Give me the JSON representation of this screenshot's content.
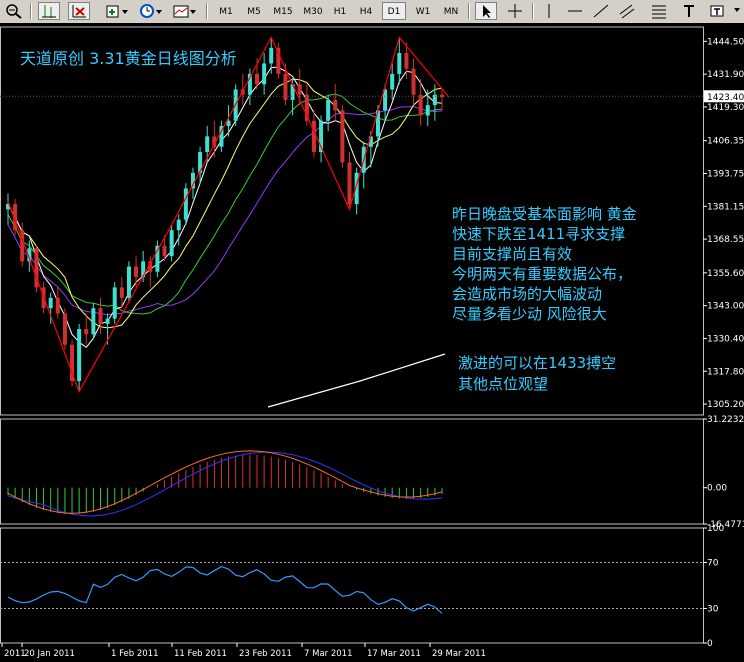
{
  "toolbar": {
    "timeframes": [
      "M1",
      "M5",
      "M15",
      "M30",
      "H1",
      "H4",
      "D1",
      "W1",
      "MN"
    ],
    "active_timeframe": "D1",
    "icons": [
      "zoom-out-icon",
      "bar-chart-icon",
      "grid-icon",
      "new-order-icon",
      "clock-icon",
      "templates-icon",
      "cursor-icon",
      "crosshair-icon",
      "line-icon",
      "horizontal-line-icon",
      "trendline-icon",
      "channel-icon",
      "fibonacci-icon",
      "text-icon",
      "label-icon"
    ]
  },
  "colors": {
    "background": "#000000",
    "bull_candle": "#40e0d0",
    "bear_candle": "#d03030",
    "ma_fast": "#ffffff",
    "ma_mid": "#ffff66",
    "ma_slow1": "#33cc33",
    "ma_slow2": "#9933ff",
    "zigzag": "#ff0000",
    "annotation": "#33ccff",
    "macd_pos": "#dd3333",
    "macd_neg": "#33cc33",
    "macd_signal": "#3333ff",
    "macd_line": "#ff6633",
    "osc_line": "#3399ff"
  },
  "annotations": {
    "title": "天道原创 3.31黄金日线图分析",
    "analysis_lines": [
      "昨日晚盘受基本面影响 黄金",
      "快速下跌至1411寻求支撑",
      "目前支撑尚且有效",
      "今明两天有重要数据公布，",
      "会造成市场的大幅波动",
      "尽量多看少动 风险很大"
    ],
    "strategy_lines": [
      "激进的可以在1433搏空",
      "其他点位观望"
    ]
  },
  "chart_data": [
    {
      "type": "candlestick",
      "yticks": [
        1444.5,
        1431.9,
        1419.3,
        1406.35,
        1393.75,
        1381.15,
        1368.55,
        1355.6,
        1343.0,
        1330.4,
        1317.8,
        1305.2
      ],
      "ylim": [
        1301,
        1450
      ],
      "current_price": 1423.4,
      "xtick_labels": [
        "2011",
        "20 Jan 2011",
        "1 Feb 2011",
        "11 Feb 2011",
        "23 Feb 2011",
        "7 Mar 2011",
        "17 Mar 2011",
        "29 Mar 2011"
      ],
      "candles_ohlc": [
        [
          1380,
          1386,
          1374,
          1382
        ],
        [
          1382,
          1384,
          1370,
          1372
        ],
        [
          1372,
          1375,
          1358,
          1360
        ],
        [
          1360,
          1368,
          1356,
          1365
        ],
        [
          1365,
          1366,
          1348,
          1350
        ],
        [
          1350,
          1352,
          1340,
          1342
        ],
        [
          1342,
          1348,
          1336,
          1346
        ],
        [
          1346,
          1350,
          1338,
          1340
        ],
        [
          1340,
          1342,
          1326,
          1328
        ],
        [
          1328,
          1330,
          1312,
          1314
        ],
        [
          1314,
          1336,
          1310,
          1334
        ],
        [
          1334,
          1340,
          1328,
          1332
        ],
        [
          1332,
          1344,
          1330,
          1342
        ],
        [
          1342,
          1346,
          1332,
          1336
        ],
        [
          1336,
          1340,
          1328,
          1338
        ],
        [
          1338,
          1352,
          1336,
          1350
        ],
        [
          1350,
          1354,
          1342,
          1346
        ],
        [
          1346,
          1360,
          1344,
          1358
        ],
        [
          1358,
          1362,
          1350,
          1354
        ],
        [
          1354,
          1364,
          1352,
          1360
        ],
        [
          1360,
          1362,
          1350,
          1356
        ],
        [
          1356,
          1368,
          1354,
          1366
        ],
        [
          1366,
          1370,
          1360,
          1362
        ],
        [
          1362,
          1374,
          1360,
          1372
        ],
        [
          1372,
          1378,
          1366,
          1376
        ],
        [
          1376,
          1390,
          1374,
          1388
        ],
        [
          1388,
          1396,
          1384,
          1394
        ],
        [
          1394,
          1404,
          1390,
          1402
        ],
        [
          1402,
          1412,
          1398,
          1408
        ],
        [
          1408,
          1414,
          1400,
          1404
        ],
        [
          1404,
          1414,
          1402,
          1412
        ],
        [
          1412,
          1420,
          1408,
          1414
        ],
        [
          1414,
          1428,
          1412,
          1426
        ],
        [
          1426,
          1432,
          1420,
          1424
        ],
        [
          1424,
          1434,
          1420,
          1432
        ],
        [
          1432,
          1438,
          1426,
          1428
        ],
        [
          1428,
          1440,
          1424,
          1436
        ],
        [
          1436,
          1446,
          1432,
          1442
        ],
        [
          1442,
          1444,
          1430,
          1432
        ],
        [
          1432,
          1436,
          1420,
          1422
        ],
        [
          1422,
          1430,
          1416,
          1428
        ],
        [
          1428,
          1434,
          1420,
          1424
        ],
        [
          1424,
          1428,
          1412,
          1414
        ],
        [
          1414,
          1418,
          1400,
          1402
        ],
        [
          1402,
          1416,
          1398,
          1414
        ],
        [
          1414,
          1424,
          1410,
          1422
        ],
        [
          1422,
          1428,
          1414,
          1418
        ],
        [
          1418,
          1420,
          1396,
          1398
        ],
        [
          1398,
          1402,
          1380,
          1382
        ],
        [
          1382,
          1396,
          1378,
          1394
        ],
        [
          1394,
          1406,
          1388,
          1404
        ],
        [
          1404,
          1410,
          1396,
          1408
        ],
        [
          1408,
          1420,
          1404,
          1418
        ],
        [
          1418,
          1428,
          1414,
          1426
        ],
        [
          1426,
          1436,
          1422,
          1432
        ],
        [
          1432,
          1446,
          1428,
          1440
        ],
        [
          1440,
          1444,
          1430,
          1434
        ],
        [
          1434,
          1438,
          1420,
          1424
        ],
        [
          1424,
          1430,
          1412,
          1416
        ],
        [
          1416,
          1426,
          1412,
          1420
        ],
        [
          1420,
          1428,
          1414,
          1424
        ],
        [
          1424,
          1426,
          1418,
          1423
        ]
      ],
      "zigzag": [
        [
          0,
          1383
        ],
        [
          10,
          1310
        ],
        [
          23,
          1374
        ],
        [
          37,
          1446
        ],
        [
          48,
          1380
        ],
        [
          55,
          1446
        ],
        [
          62,
          1423
        ]
      ]
    },
    {
      "type": "macd",
      "yticks": [
        31.2232,
        0.0,
        -16.4771
      ],
      "ylim": [
        -16.4771,
        31.2232
      ]
    },
    {
      "type": "oscillator",
      "yticks": [
        100,
        70,
        30,
        0
      ],
      "ylim": [
        0,
        100
      ],
      "levels": [
        70,
        30
      ]
    }
  ]
}
